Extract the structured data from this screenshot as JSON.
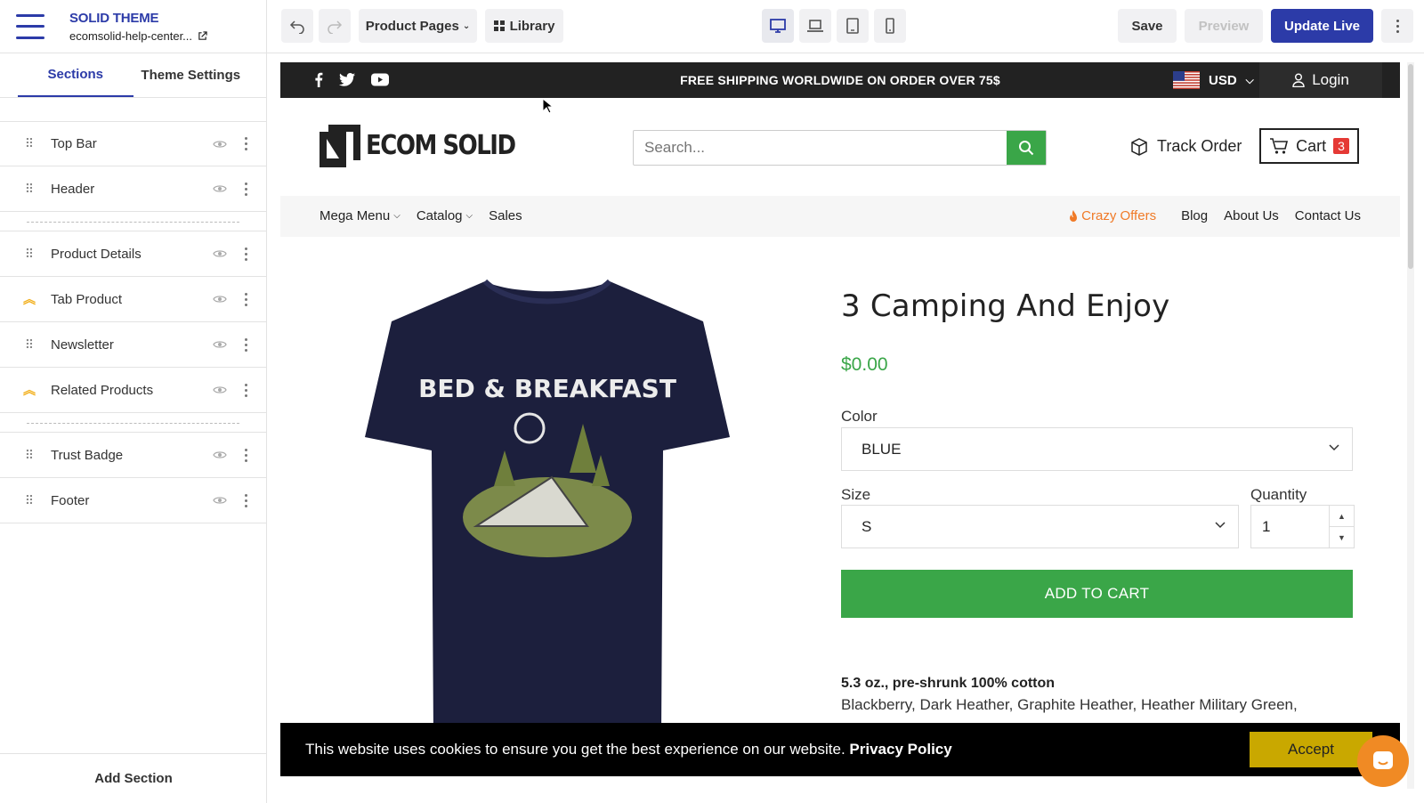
{
  "app": {
    "brand_title": "SOLID THEME",
    "brand_subtitle": "ecomsolid-help-center..."
  },
  "sidebar": {
    "tabs": [
      "Sections",
      "Theme Settings"
    ],
    "active_tab": "Sections",
    "sections": [
      {
        "label": "Top Bar",
        "icon": "drag-handle-icon"
      },
      {
        "label": "Header",
        "icon": "drag-handle-icon"
      },
      {
        "label": "Product Details",
        "icon": "drag-handle-icon"
      },
      {
        "label": "Tab Product",
        "icon": "chevron-up-double-icon"
      },
      {
        "label": "Newsletter",
        "icon": "drag-handle-icon"
      },
      {
        "label": "Related Products",
        "icon": "chevron-up-double-icon"
      },
      {
        "label": "Trust Badge",
        "icon": "drag-handle-icon"
      },
      {
        "label": "Footer",
        "icon": "drag-handle-icon"
      }
    ],
    "add_section": "Add Section"
  },
  "toolbar": {
    "page_select": "Product Pages",
    "library": "Library",
    "save": "Save",
    "preview": "Preview",
    "update_live": "Update Live"
  },
  "store": {
    "topbar": {
      "shipping": "FREE SHIPPING WORLDWIDE ON ORDER OVER 75$",
      "currency": "USD",
      "login": "Login"
    },
    "logo_text": "ECOM SOLID",
    "search_placeholder": "Search...",
    "track_order": "Track Order",
    "cart_label": "Cart",
    "cart_count": "3",
    "nav_left": [
      "Mega Menu",
      "Catalog",
      "Sales"
    ],
    "nav_offer": "Crazy Offers",
    "nav_right": [
      "Blog",
      "About Us",
      "Contact Us"
    ]
  },
  "product": {
    "title": "3 Camping And Enjoy",
    "price": "$0.00",
    "color_label": "Color",
    "color_value": "BLUE",
    "size_label": "Size",
    "size_value": "S",
    "qty_label": "Quantity",
    "qty_value": "1",
    "add_to_cart": "ADD TO CART",
    "desc_bold": "5.3 oz., pre-shrunk 100% cotton",
    "desc_text": "Blackberry, Dark Heather, Graphite Heather, Heather Military Green,",
    "graphic_text": "BED & BREAKFAST"
  },
  "cookie": {
    "text": "This website uses cookies to ensure you get the best experience on our website.",
    "link": "Privacy Policy",
    "accept": "Accept"
  },
  "colors": {
    "brand_blue": "#2c3ba8",
    "green": "#3aa648",
    "offer_orange": "#f07a27",
    "accept_yellow": "#c9a800"
  }
}
